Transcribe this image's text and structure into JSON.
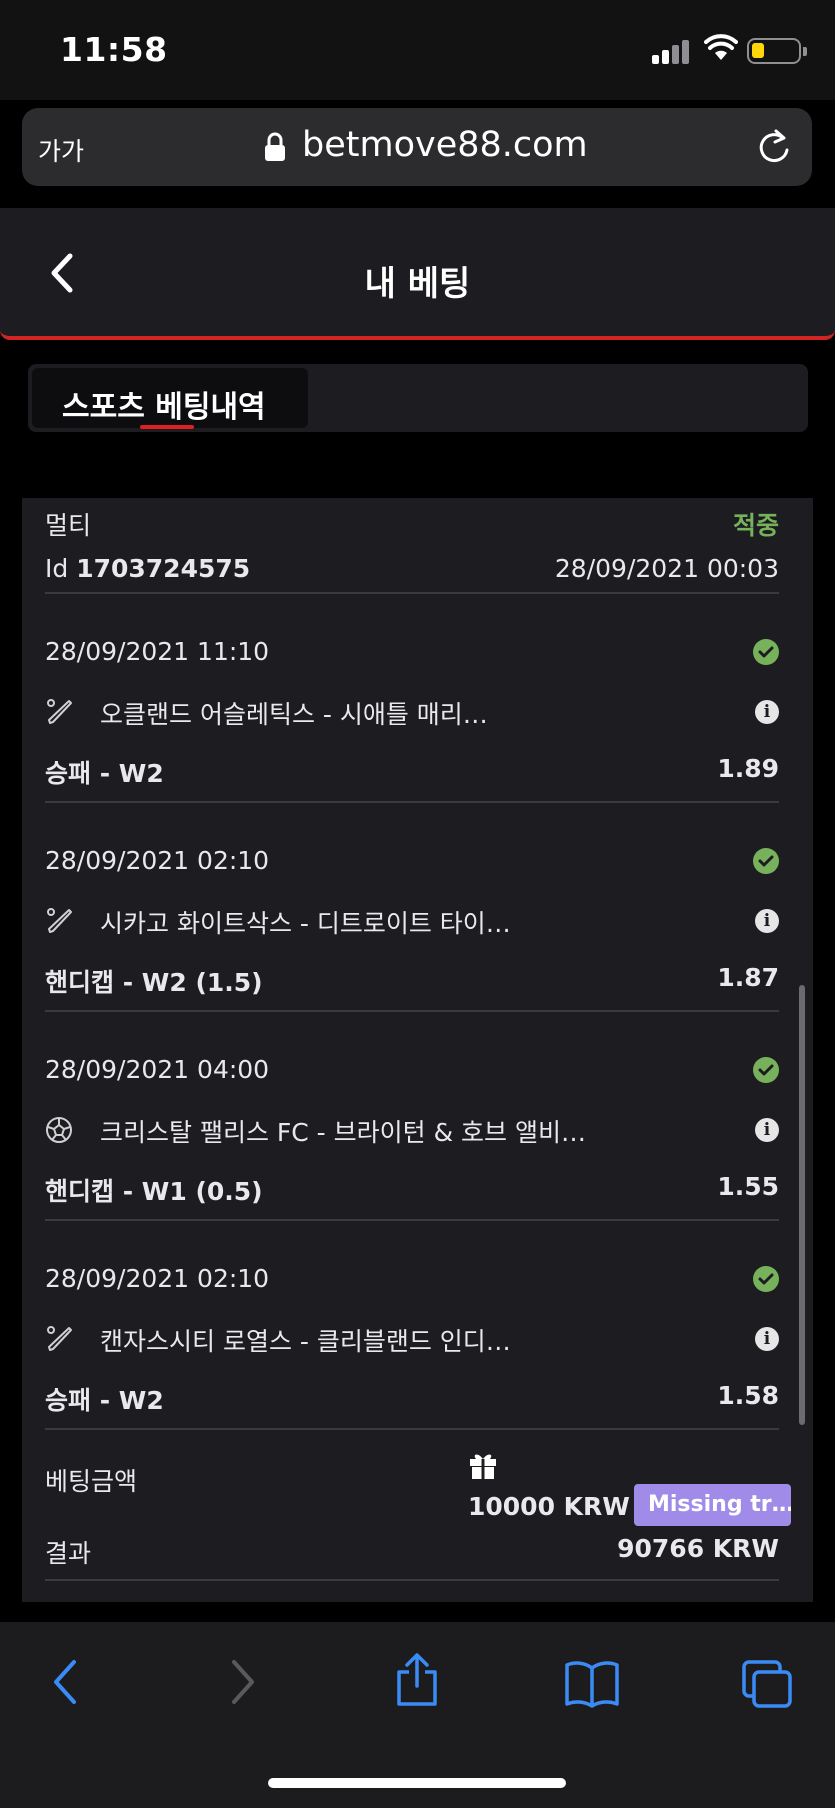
{
  "status_bar": {
    "time": "11:58"
  },
  "browser": {
    "aa_label": "가가",
    "url": "betmove88.com"
  },
  "header": {
    "title": "내 베팅"
  },
  "tabs": [
    {
      "label": "스포츠 베팅내역"
    }
  ],
  "bet": {
    "type": "멀티",
    "status": "적중",
    "id_label": "Id",
    "id_value": "1703724575",
    "date": "28/09/2021 00:03",
    "selections": [
      {
        "date": "28/09/2021 11:10",
        "sport_icon": "baseball-bat-icon",
        "event": "오클랜드 어슬레틱스 - 시애틀 매리…",
        "market": "승패 - W2",
        "odds": "1.89"
      },
      {
        "date": "28/09/2021 02:10",
        "sport_icon": "baseball-bat-icon",
        "event": "시카고 화이트삭스 - 디트로이트 타이…",
        "market": "핸디캡 - W2 (1.5)",
        "odds": "1.87"
      },
      {
        "date": "28/09/2021 04:00",
        "sport_icon": "soccer-ball-icon",
        "event": "크리스탈 팰리스 FC - 브라이턴 & 호브 앨비…",
        "market": "핸디캡 - W1 (0.5)",
        "odds": "1.55"
      },
      {
        "date": "28/09/2021 02:10",
        "sport_icon": "baseball-bat-icon",
        "event": "캔자스시티 로열스 - 클리블랜드 인디…",
        "market": "승패 - W2",
        "odds": "1.58"
      }
    ],
    "stake_label": "베팅금액",
    "stake_amount": "10000 KRW",
    "badge": "Missing tr…",
    "result_label": "결과",
    "result_amount": "90766 KRW"
  },
  "colors": {
    "win": "#78b15b",
    "accent_red": "#d32424",
    "badge": "#a08ce8",
    "ios_blue": "#3a8bf5"
  }
}
